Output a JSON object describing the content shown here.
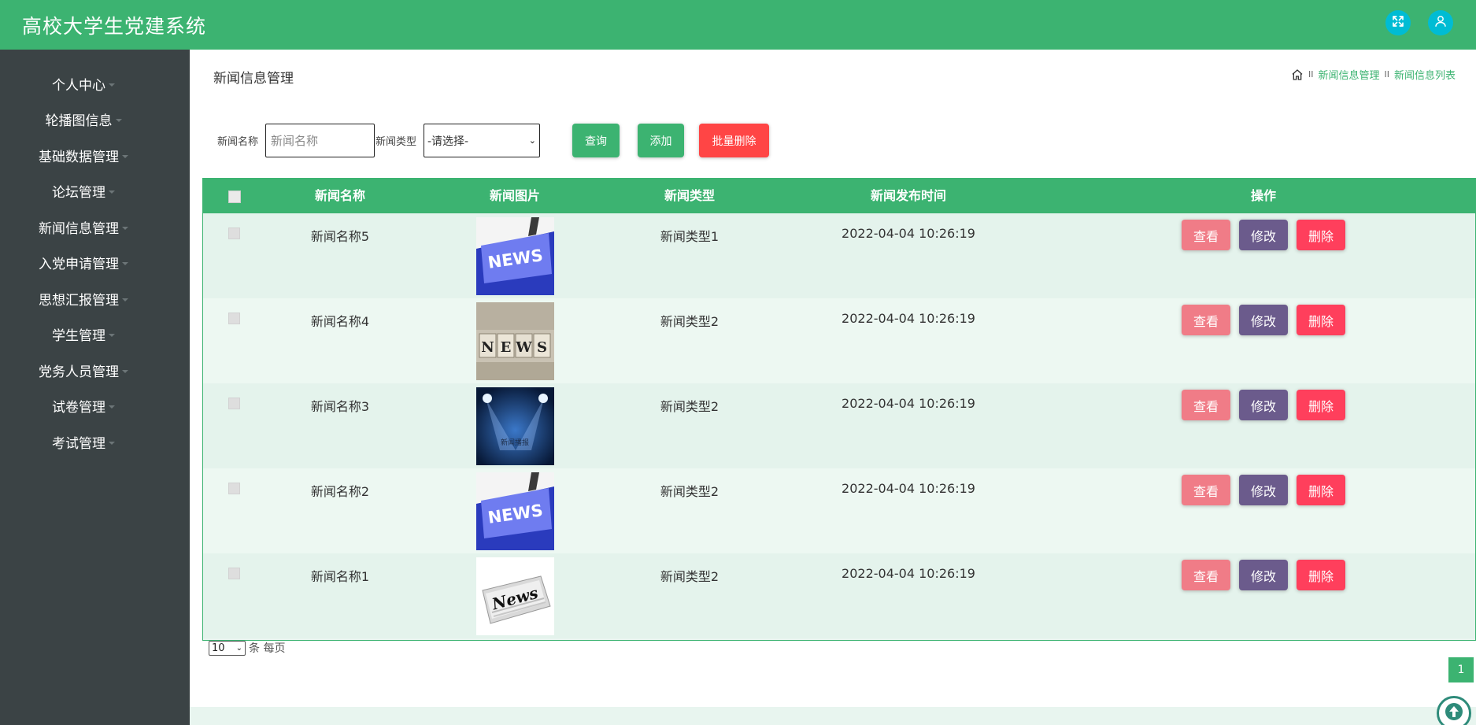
{
  "app": {
    "title": "高校大学生党建系统"
  },
  "header": {
    "fullscreen_icon": "fullscreen-icon",
    "user_icon": "user-icon"
  },
  "sidebar": {
    "items": [
      {
        "label": "个人中心"
      },
      {
        "label": "轮播图信息"
      },
      {
        "label": "基础数据管理"
      },
      {
        "label": "论坛管理"
      },
      {
        "label": "新闻信息管理"
      },
      {
        "label": "入党申请管理"
      },
      {
        "label": "思想汇报管理"
      },
      {
        "label": "学生管理"
      },
      {
        "label": "党务人员管理"
      },
      {
        "label": "试卷管理"
      },
      {
        "label": "考试管理"
      }
    ]
  },
  "page": {
    "title": "新闻信息管理",
    "breadcrumb": {
      "separator": "II",
      "level1": "新闻信息管理",
      "level2": "新闻信息列表"
    }
  },
  "search": {
    "name_label": "新闻名称",
    "name_placeholder": "新闻名称",
    "type_label": "新闻类型",
    "type_selected": "-请选择-",
    "query_label": "查询",
    "add_label": "添加",
    "batch_delete_label": "批量删除"
  },
  "table": {
    "headers": [
      "新闻名称",
      "新闻图片",
      "新闻类型",
      "新闻发布时间",
      "操作"
    ],
    "rows": [
      {
        "name": "新闻名称5",
        "image": "news-keyboard",
        "type": "新闻类型1",
        "time": "2022-04-04 10:26:19"
      },
      {
        "name": "新闻名称4",
        "image": "news-blocks",
        "type": "新闻类型2",
        "time": "2022-04-04 10:26:19"
      },
      {
        "name": "新闻名称3",
        "image": "news-stage",
        "type": "新闻类型2",
        "time": "2022-04-04 10:26:19"
      },
      {
        "name": "新闻名称2",
        "image": "news-keyboard",
        "type": "新闻类型2",
        "time": "2022-04-04 10:26:19"
      },
      {
        "name": "新闻名称1",
        "image": "news-paper",
        "type": "新闻类型2",
        "time": "2022-04-04 10:26:19"
      }
    ],
    "actions": {
      "view": "查看",
      "edit": "修改",
      "delete": "删除"
    }
  },
  "pagination": {
    "page_size": "10",
    "per_page_text": "条 每页",
    "current_page": "1"
  },
  "thumbs": {
    "stage_caption": "新闻播报",
    "news_word": "NEWS",
    "paper_word": "News"
  },
  "colors": {
    "primary": "#3cb371",
    "sidebar": "#3b4345",
    "view": "#f07c87",
    "edit": "#6b5b8c",
    "delete": "#ff3f5c",
    "batch_delete": "#ff4545",
    "icon_circle": "#00bcd4"
  }
}
